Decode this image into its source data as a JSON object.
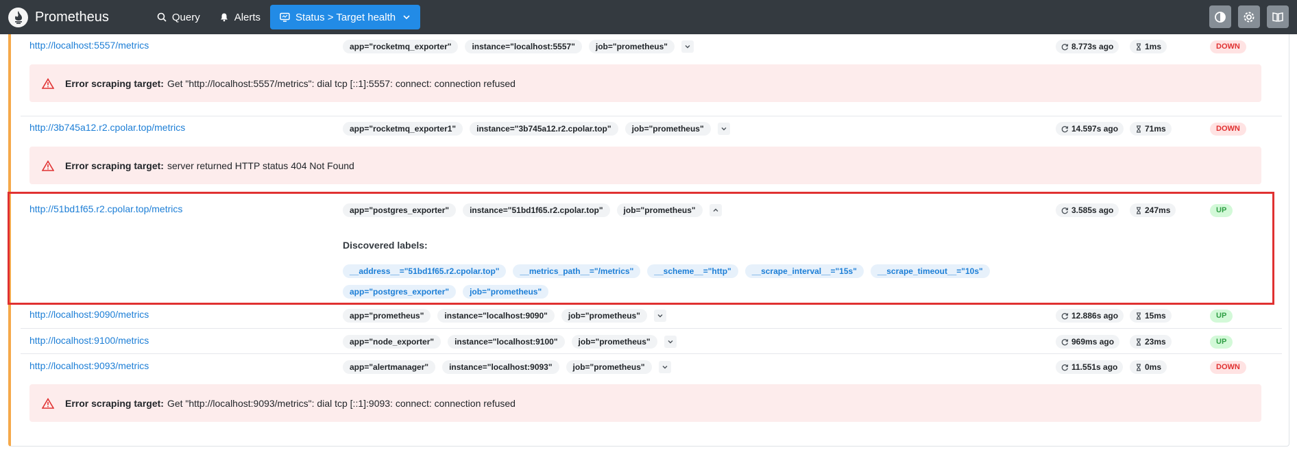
{
  "header": {
    "brand": "Prometheus",
    "nav": [
      {
        "label": "Query"
      },
      {
        "label": "Alerts"
      },
      {
        "label": "Status > Target health"
      }
    ]
  },
  "targets": [
    {
      "url": "http://localhost:5557/metrics",
      "labels": [
        "app=\"rocketmq_exporter\"",
        "instance=\"localhost:5557\"",
        "job=\"prometheus\""
      ],
      "last_scrape": "8.773s ago",
      "duration": "1ms",
      "status": "DOWN",
      "error_prefix": "Error scraping target:",
      "error": "Get \"http://localhost:5557/metrics\": dial tcp [::1]:5557: connect: connection refused"
    },
    {
      "url": "http://3b745a12.r2.cpolar.top/metrics",
      "labels": [
        "app=\"rocketmq_exporter1\"",
        "instance=\"3b745a12.r2.cpolar.top\"",
        "job=\"prometheus\""
      ],
      "last_scrape": "14.597s ago",
      "duration": "71ms",
      "status": "DOWN",
      "error_prefix": "Error scraping target:",
      "error": "server returned HTTP status 404 Not Found"
    },
    {
      "url": "http://51bd1f65.r2.cpolar.top/metrics",
      "labels": [
        "app=\"postgres_exporter\"",
        "instance=\"51bd1f65.r2.cpolar.top\"",
        "job=\"prometheus\""
      ],
      "last_scrape": "3.585s ago",
      "duration": "247ms",
      "status": "UP",
      "discovered_title": "Discovered labels:",
      "discovered_row1": [
        "__address__=\"51bd1f65.r2.cpolar.top\"",
        "__metrics_path__=\"/metrics\"",
        "__scheme__=\"http\"",
        "__scrape_interval__=\"15s\"",
        "__scrape_timeout__=\"10s\""
      ],
      "discovered_row2": [
        "app=\"postgres_exporter\"",
        "job=\"prometheus\""
      ]
    },
    {
      "url": "http://localhost:9090/metrics",
      "labels": [
        "app=\"prometheus\"",
        "instance=\"localhost:9090\"",
        "job=\"prometheus\""
      ],
      "last_scrape": "12.886s ago",
      "duration": "15ms",
      "status": "UP"
    },
    {
      "url": "http://localhost:9100/metrics",
      "labels": [
        "app=\"node_exporter\"",
        "instance=\"localhost:9100\"",
        "job=\"prometheus\""
      ],
      "last_scrape": "969ms ago",
      "duration": "23ms",
      "status": "UP"
    },
    {
      "url": "http://localhost:9093/metrics",
      "labels": [
        "app=\"alertmanager\"",
        "instance=\"localhost:9093\"",
        "job=\"prometheus\""
      ],
      "last_scrape": "11.551s ago",
      "duration": "0ms",
      "status": "DOWN",
      "error_prefix": "Error scraping target:",
      "error": "Get \"http://localhost:9093/metrics\": dial tcp [::1]:9093: connect: connection refused"
    }
  ]
}
